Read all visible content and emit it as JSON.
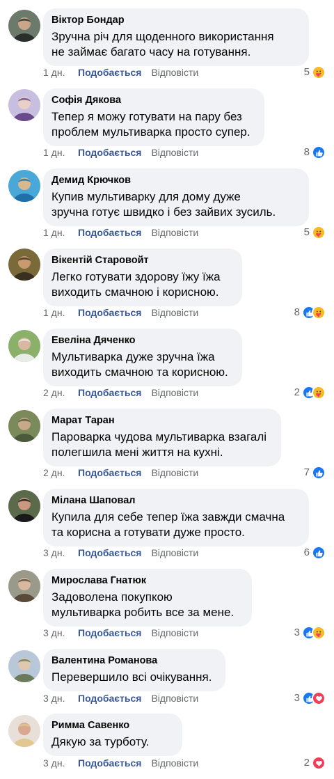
{
  "colors": {
    "like_blue": "#1877f2",
    "care_yellow": "#f7b928",
    "love_red": "#f33e58",
    "link_blue": "#385898",
    "bubble_bg": "#f0f2f5",
    "muted_text": "#65676b"
  },
  "comments": [
    {
      "author": "Віктор Бондар",
      "text": "Зручна річ для щоденного використання\nне займає багато часу на готування.",
      "time": "1 дн.",
      "like_label": "Подобається",
      "reply_label": "Відповісти",
      "reaction_count": "5",
      "reactions": [
        "care-icon"
      ],
      "avatar_colors": [
        "#6b7a6a",
        "#2b2f2b",
        "#c9a58a"
      ]
    },
    {
      "author": "Софія Дякова",
      "text": "Тепер я можу готувати на пару без\nпроблем мультиварка просто супер.",
      "time": "1 дн.",
      "like_label": "Подобається",
      "reply_label": "Відповісти",
      "reaction_count": "8",
      "reactions": [
        "like-icon"
      ],
      "avatar_colors": [
        "#c8bfe0",
        "#6a4a8a",
        "#e8d0c8"
      ]
    },
    {
      "author": "Демид Крючков",
      "text": "Купив мультиварку для дому дуже\nзручна готує швидко і без зайвих зусиль.",
      "time": "1 дн.",
      "like_label": "Подобається",
      "reply_label": "Відповісти",
      "reaction_count": "5",
      "reactions": [
        "care-icon"
      ],
      "avatar_colors": [
        "#4aa8d8",
        "#1f6fa8",
        "#d8b890"
      ]
    },
    {
      "author": "Вікентій Старовойт",
      "text": "Легко готувати здорову їжу їжа\nвиходить смачною і корисною.",
      "time": "1 дн.",
      "like_label": "Подобається",
      "reply_label": "Відповісти",
      "reaction_count": "8",
      "reactions": [
        "like-icon",
        "care-icon"
      ],
      "avatar_colors": [
        "#7a6a3a",
        "#3a3020",
        "#c89a70"
      ]
    },
    {
      "author": "Евеліна Дяченко",
      "text": "Мультиварка дуже зручна їжа\nвиходить смачною та корисною.",
      "time": "2 дн.",
      "like_label": "Подобається",
      "reply_label": "Відповісти",
      "reaction_count": "2",
      "reactions": [
        "like-icon",
        "care-icon"
      ],
      "avatar_colors": [
        "#8ab06a",
        "#e8ece8",
        "#d8b8a0"
      ]
    },
    {
      "author": "Марат Таран",
      "text": "Пароварка чудова мультиварка взагалі\nполегшила мені життя на кухні.",
      "time": "2 дн.",
      "like_label": "Подобається",
      "reply_label": "Відповісти",
      "reaction_count": "7",
      "reactions": [
        "like-icon"
      ],
      "avatar_colors": [
        "#7a8a5a",
        "#4a5a3a",
        "#c8a888"
      ]
    },
    {
      "author": "Мілана Шаповал",
      "text": "Купила для себе тепер їжа завжди смачна\nта корисна а готувати дуже просто.",
      "time": "3 дн.",
      "like_label": "Подобається",
      "reply_label": "Відповісти",
      "reaction_count": "6",
      "reactions": [
        "like-icon"
      ],
      "avatar_colors": [
        "#5a6a4a",
        "#1a1a1a",
        "#c89880"
      ]
    },
    {
      "author": "Мирослава Гнатюк",
      "text": "Задоволена покупкою\nмультиварка робить все за мене.",
      "time": "3 дн.",
      "like_label": "Подобається",
      "reply_label": "Відповісти",
      "reaction_count": "3",
      "reactions": [
        "like-icon",
        "care-icon"
      ],
      "avatar_colors": [
        "#9a9a8a",
        "#5a4a3a",
        "#d8b8a0"
      ]
    },
    {
      "author": "Валентина Романова",
      "text": "Перевершило всі очікування.",
      "time": "3 дн.",
      "like_label": "Подобається",
      "reply_label": "Відповісти",
      "reaction_count": "3",
      "reactions": [
        "like-icon",
        "love-icon"
      ],
      "avatar_colors": [
        "#b8c8d8",
        "#6a7a5a",
        "#e0c8b0"
      ]
    },
    {
      "author": "Римма Савенко",
      "text": "Дякую за турботу.",
      "time": "3 дн.",
      "like_label": "Подобається",
      "reply_label": "Відповісти",
      "reaction_count": "2",
      "reactions": [
        "love-icon"
      ],
      "avatar_colors": [
        "#e8e0d8",
        "#e0c890",
        "#d8a890"
      ]
    }
  ]
}
